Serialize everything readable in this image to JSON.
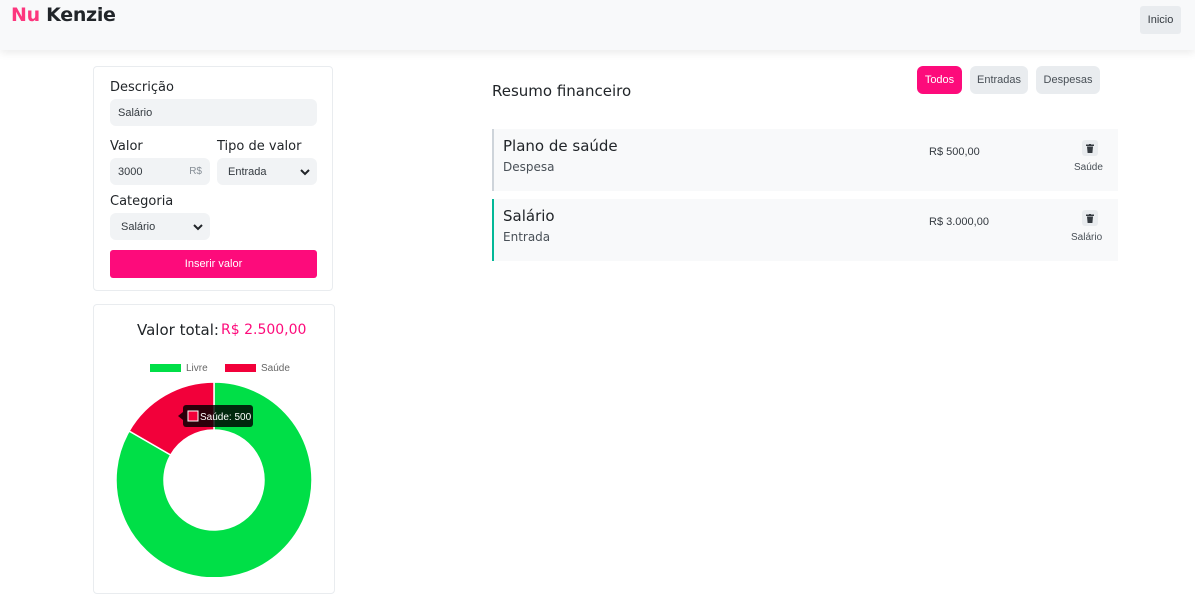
{
  "header": {
    "logo_accent": "Nu",
    "logo_rest": "Kenzie",
    "home_label": "Inicio"
  },
  "form": {
    "description_label": "Descrição",
    "description_value": "Salário",
    "value_label": "Valor",
    "value_value": "3000",
    "value_suffix": "R$",
    "type_label": "Tipo de valor",
    "type_value": "Entrada",
    "category_label": "Categoria",
    "category_value": "Salário",
    "submit_label": "Inserir valor"
  },
  "total": {
    "label": "Valor total:",
    "value": "R$ 2.500,00"
  },
  "chart_data": {
    "type": "pie",
    "categories": [
      "Livre",
      "Saúde"
    ],
    "values": [
      2500,
      500
    ],
    "colors": [
      "#00df47",
      "#f2003a"
    ],
    "legend_position": "top",
    "tooltip": "Saúde: 500"
  },
  "summary": {
    "title": "Resumo financeiro",
    "filters": [
      "Todos",
      "Entradas",
      "Despesas"
    ],
    "active_filter": "Todos"
  },
  "entries": [
    {
      "name": "Plano de saúde",
      "type": "Despesa",
      "amount": "R$ 500,00",
      "category": "Saúde"
    },
    {
      "name": "Salário",
      "type": "Entrada",
      "amount": "R$ 3.000,00",
      "category": "Salário"
    }
  ],
  "colors": {
    "accent": "#fd0b7b",
    "income_border": "#03b898",
    "expense_border": "#ced4da"
  },
  "icons": {
    "trash": "trash-icon",
    "chevron": "chevron-down-icon"
  }
}
